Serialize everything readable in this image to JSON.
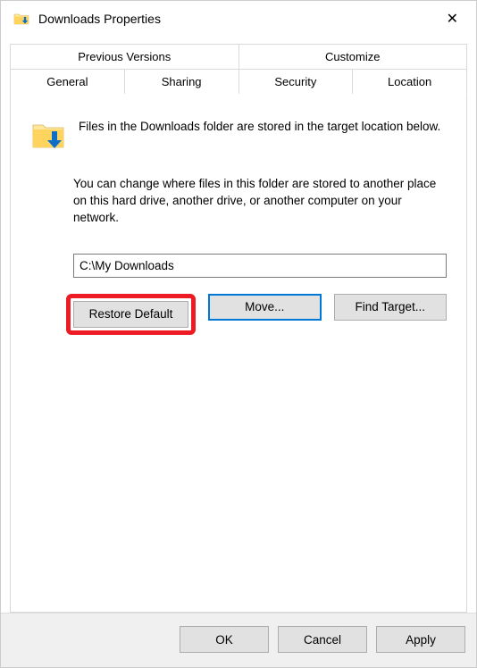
{
  "title": "Downloads Properties",
  "tabs": {
    "top": [
      "Previous Versions",
      "Customize"
    ],
    "bottom": [
      "General",
      "Sharing",
      "Security",
      "Location"
    ]
  },
  "activeTab": "Location",
  "content": {
    "desc": "Files in the Downloads folder are stored in the target location below.",
    "info": "You can change where files in this folder are stored to another place on this hard drive, another drive, or another computer on your network.",
    "path": "C:\\My Downloads",
    "buttons": {
      "restore": "Restore Default",
      "move": "Move...",
      "find": "Find Target..."
    }
  },
  "footer": {
    "ok": "OK",
    "cancel": "Cancel",
    "apply": "Apply"
  }
}
